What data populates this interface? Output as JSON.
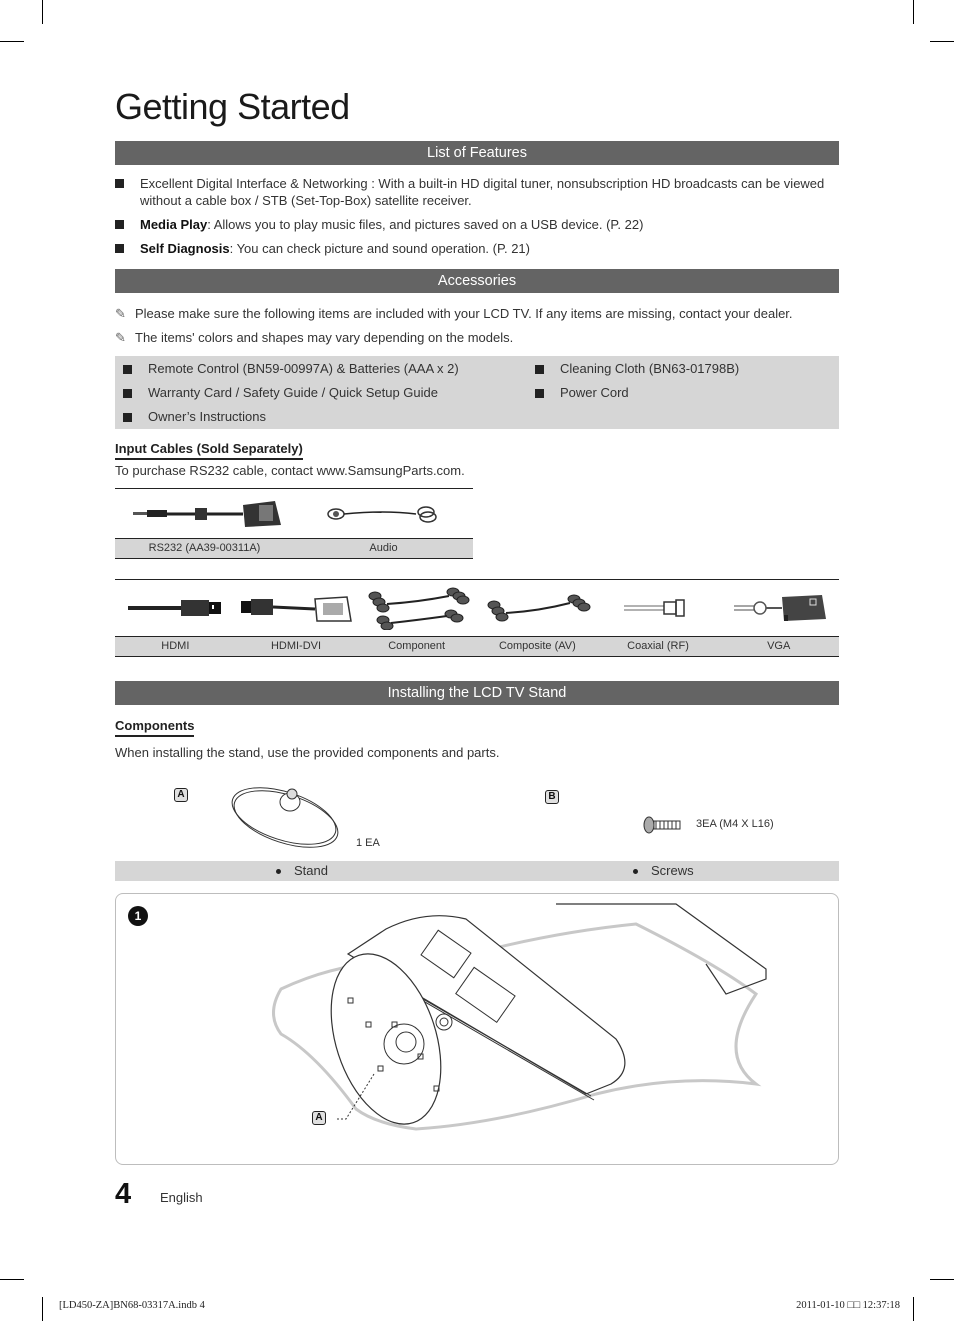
{
  "page": {
    "title": "Getting Started",
    "page_number": "4",
    "language": "English"
  },
  "features": {
    "header": "List of Features",
    "items": [
      {
        "bold": "",
        "text": "Excellent Digital Interface & Networking : With a built-in HD digital tuner, nonsubscription HD broadcasts can be viewed without a cable box / STB (Set-Top-Box) satellite receiver."
      },
      {
        "bold": "Media Play",
        "text": ": Allows you to play music files, and pictures saved on a USB device. (P. 22)"
      },
      {
        "bold": "Self Diagnosis",
        "text": ": You can check picture and sound operation. (P. 21)"
      }
    ]
  },
  "accessories": {
    "header": "Accessories",
    "notes": [
      "Please make sure the following items are included with your LCD TV. If any items are missing, contact your dealer.",
      "The items' colors and shapes may vary depending on the models."
    ],
    "note_icon": "pencil-note-icon",
    "items_left": [
      "Remote Control (BN59-00997A) & Batteries (AAA x 2)",
      "Warranty Card / Safety Guide / Quick Setup Guide",
      "Owner’s Instructions"
    ],
    "items_right": [
      "Cleaning Cloth (BN63-01798B)",
      "Power Cord"
    ]
  },
  "input_cables": {
    "heading": "Input Cables (Sold Separately)",
    "note": "To purchase RS232 cable, contact www.SamsungParts.com.",
    "table1": [
      "RS232 (AA39-00311A)",
      "Audio"
    ],
    "table2": [
      "HDMI",
      "HDMI-DVI",
      "Component",
      "Composite (AV)",
      "Coaxial (RF)",
      "VGA"
    ]
  },
  "stand": {
    "header": "Installing the LCD TV Stand",
    "components_heading": "Components",
    "components_note": "When installing the stand, use the provided components and parts.",
    "part_a": {
      "badge": "A",
      "qty": "1 EA",
      "name": "Stand"
    },
    "part_b": {
      "badge": "B",
      "qty": "3EA (M4 X L16)",
      "name": "Screws"
    },
    "step": {
      "number": "1",
      "callout": "A"
    }
  },
  "footer": {
    "file": "[LD450-ZA]BN68-03317A.indb   4",
    "timestamp": "2011-01-10   □□ 12:37:18"
  }
}
